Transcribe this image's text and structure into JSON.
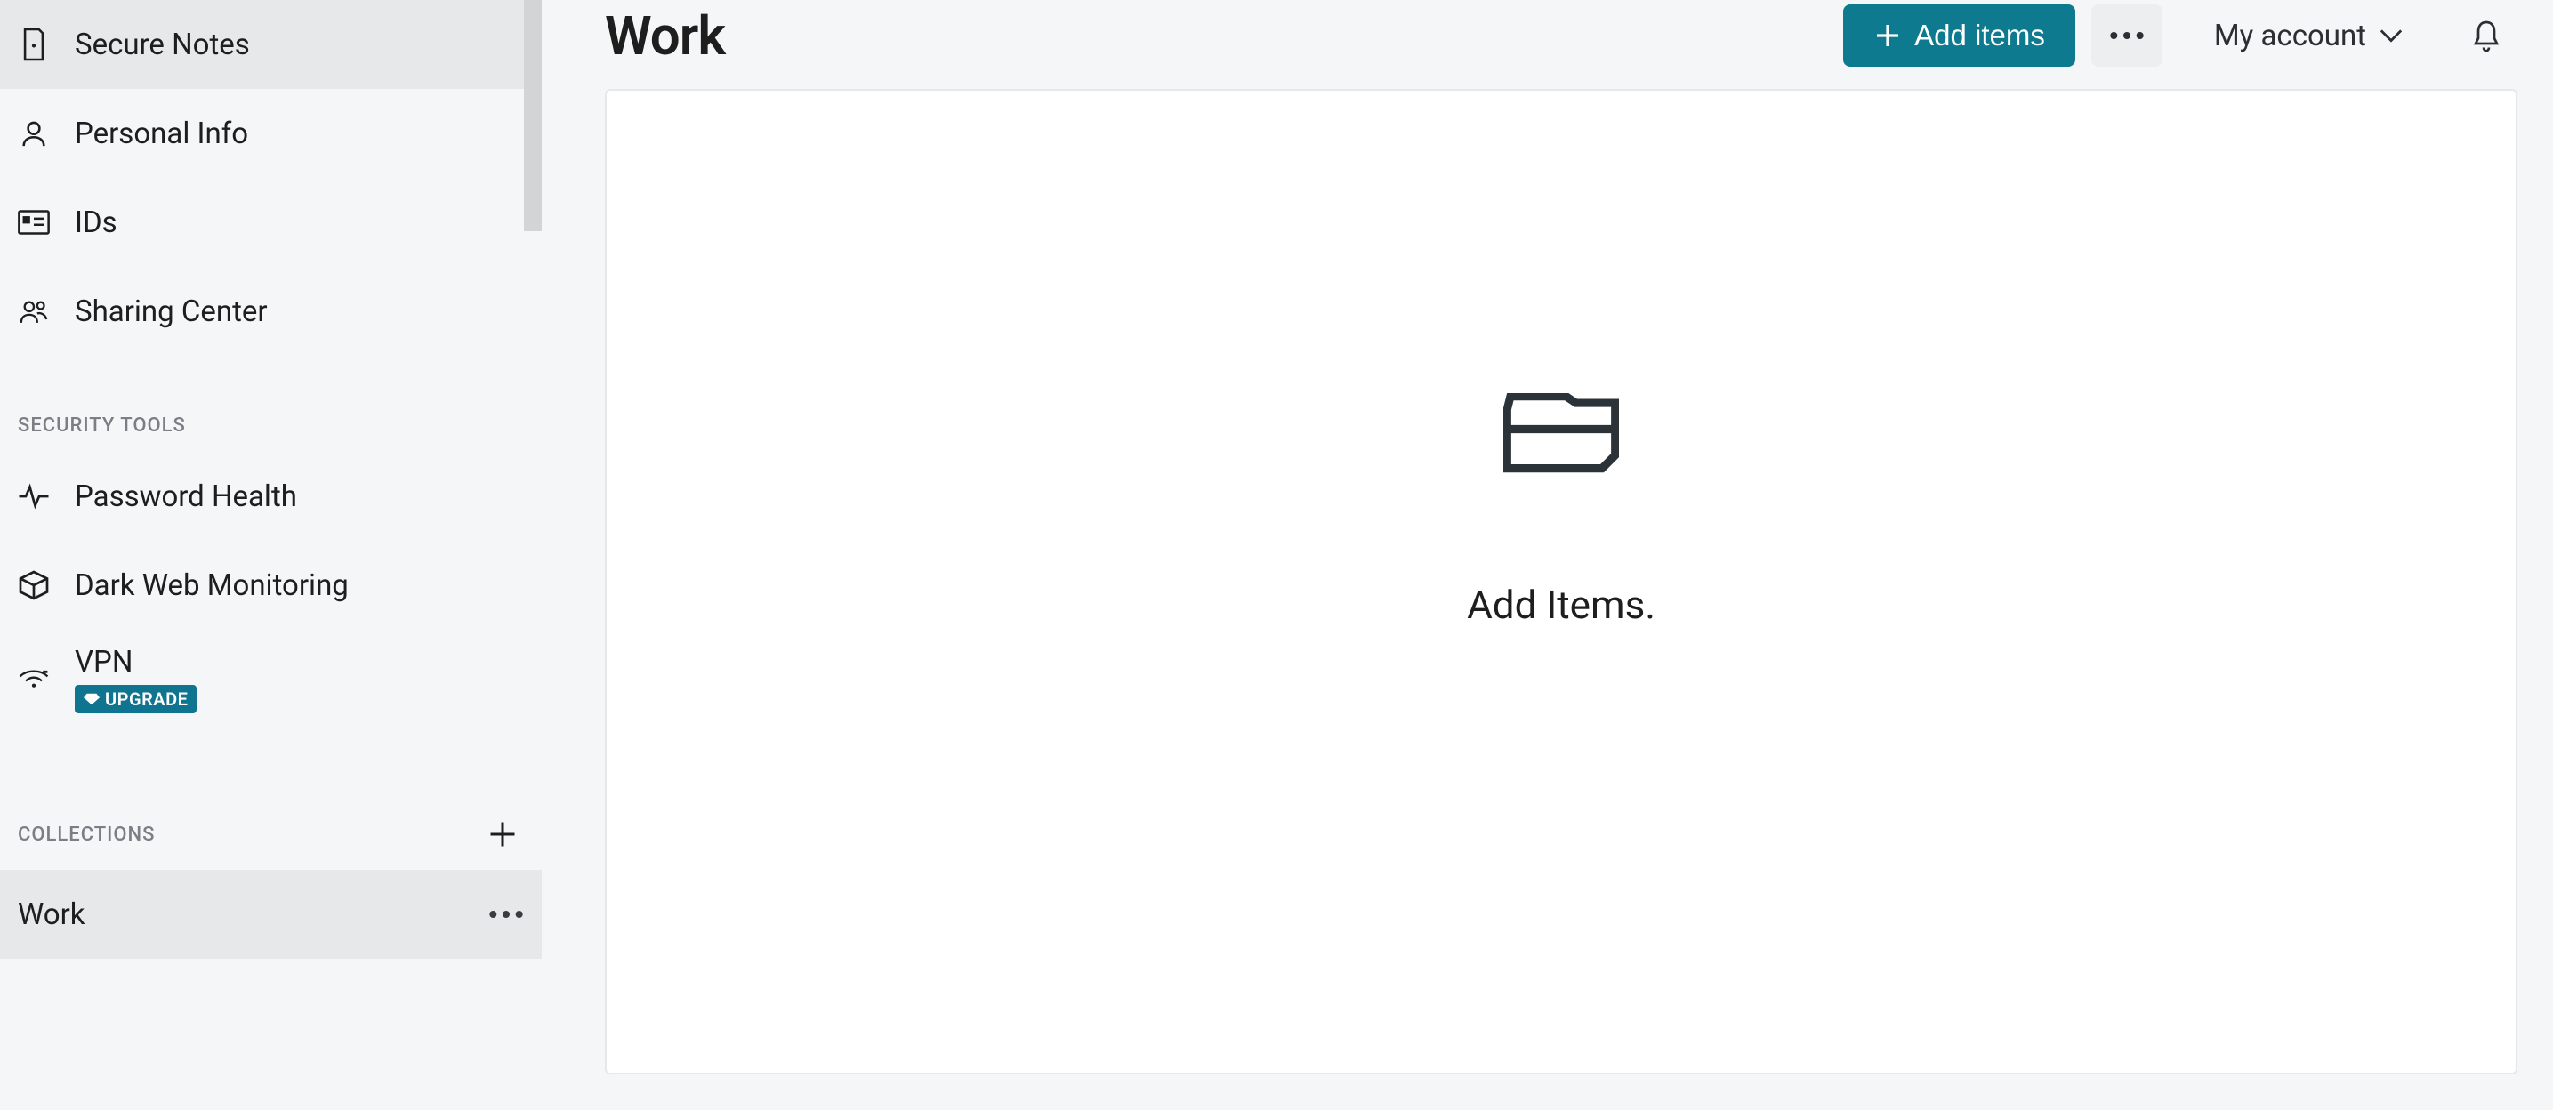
{
  "sidebar": {
    "nav": [
      {
        "label": "Secure Notes"
      },
      {
        "label": "Personal Info"
      },
      {
        "label": "IDs"
      },
      {
        "label": "Sharing Center"
      }
    ],
    "section_security_label": "SECURITY TOOLS",
    "security_tools": [
      {
        "label": "Password Health"
      },
      {
        "label": "Dark Web Monitoring"
      },
      {
        "label": "VPN",
        "badge": "UPGRADE"
      }
    ],
    "section_collections_label": "COLLECTIONS",
    "collections": [
      {
        "label": "Work"
      }
    ]
  },
  "header": {
    "title": "Work",
    "add_items_label": "Add items",
    "account_label": "My account"
  },
  "empty_state": {
    "message": "Add Items."
  },
  "colors": {
    "accent": "#0d7a8f",
    "badge": "#0e7490"
  }
}
